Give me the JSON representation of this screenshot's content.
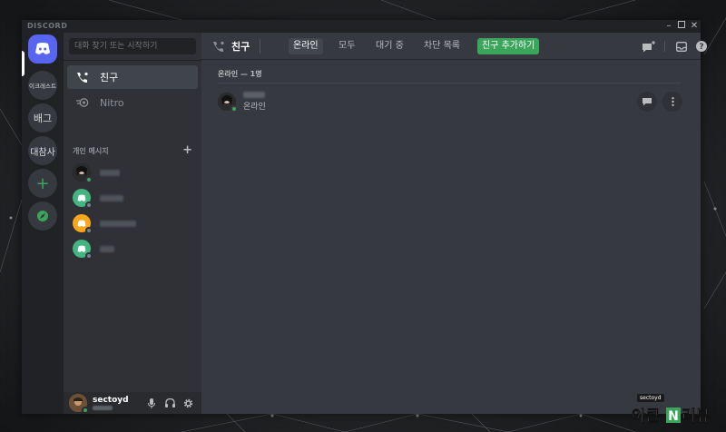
{
  "window": {
    "brand": "DISCORD",
    "controls": [
      "minimize",
      "maximize",
      "close"
    ]
  },
  "guilds": [
    {
      "label": "",
      "kind": "home",
      "icon": "discord-logo-icon"
    },
    {
      "label": "이크레스트",
      "kind": "server"
    },
    {
      "label": "배그",
      "kind": "server"
    },
    {
      "label": "대참사",
      "kind": "server"
    },
    {
      "label": "+",
      "kind": "add-server",
      "icon": "plus-icon"
    },
    {
      "label": "",
      "kind": "explore",
      "icon": "compass-icon"
    }
  ],
  "sidebar": {
    "search_placeholder": "대화 찾기 또는 시작하기",
    "nav": [
      {
        "label": "친구",
        "icon": "friends-phone-icon",
        "active": true
      },
      {
        "label": "Nitro",
        "icon": "nitro-icon",
        "active": false
      }
    ],
    "dm_header": "개인 메시지",
    "dm_add": "+",
    "dms": [
      {
        "avatar": "photo",
        "color": "#1a1a1a",
        "status": "online",
        "status_color": "#3ba55c"
      },
      {
        "avatar": "discord",
        "color": "#43b581",
        "status": "offline",
        "status_color": "#747f8d"
      },
      {
        "avatar": "discord",
        "color": "#faa61a",
        "status": "offline",
        "status_color": "#747f8d"
      },
      {
        "avatar": "discord",
        "color": "#43b581",
        "status": "offline",
        "status_color": "#747f8d"
      }
    ]
  },
  "user_panel": {
    "name": "sectoyd",
    "controls": [
      "microphone-icon",
      "headphones-icon",
      "settings-gear-icon"
    ]
  },
  "topbar": {
    "title": "친구",
    "tabs": [
      {
        "label": "온라인",
        "active": true
      },
      {
        "label": "모두",
        "active": false
      },
      {
        "label": "대기 중",
        "active": false
      },
      {
        "label": "차단 목록",
        "active": false
      }
    ],
    "add_friend": "친구 추가하기",
    "icons": [
      "new-group-dm-icon",
      "inbox-icon",
      "help-icon"
    ]
  },
  "friends_section": {
    "title": "온라인 — 1명",
    "friends": [
      {
        "status_text": "온라인",
        "status_color": "#3ba55c"
      }
    ]
  },
  "watermark": {
    "tag": "sectoyd",
    "text": "아큰N리뷰"
  },
  "colors": {
    "blurple": "#5865f2",
    "green": "#3ba55c",
    "bg_main": "#36393f",
    "bg_sidebar": "#2f3136",
    "bg_rail": "#202225"
  }
}
